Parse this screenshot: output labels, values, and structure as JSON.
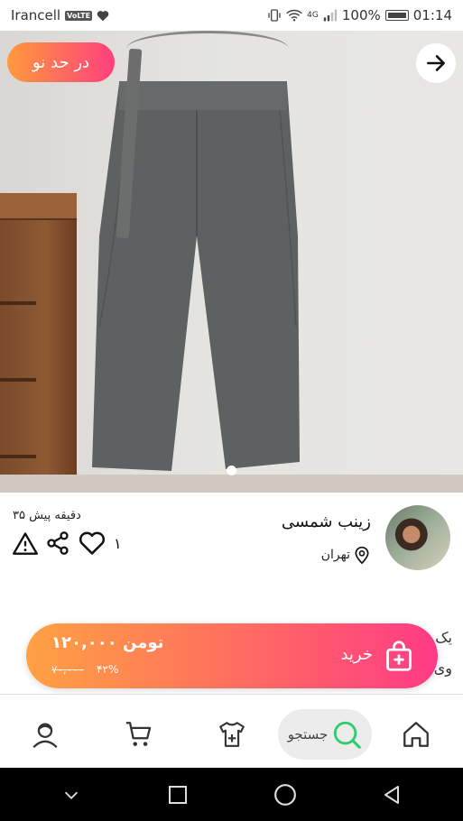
{
  "status_bar": {
    "carrier": "Irancell",
    "volte": "VoLTE",
    "battery": "100%",
    "time": "01:14",
    "network": "4G"
  },
  "product": {
    "condition_badge": "در حد نو",
    "image_index": 1,
    "image_count": 1
  },
  "seller": {
    "name": "زینب شمسی",
    "location": "تهران",
    "posted": "۳۵ دقیقه پیش",
    "likes": "۱"
  },
  "description_peek": [
    "یک",
    "وی"
  ],
  "buy": {
    "label": "خرید",
    "price": "۱۲۰,۰۰۰ تومن",
    "original_price": "۷۰,۰۰۰",
    "discount": "۴۲%"
  },
  "nav": {
    "search_label": "جستجو",
    "items": [
      "home-icon",
      "search-icon",
      "add-product-icon",
      "cart-icon",
      "profile-icon"
    ]
  },
  "colors": {
    "accent_start": "#ffa143",
    "accent_end": "#ff3a86",
    "search_icon": "#2ecc71"
  }
}
